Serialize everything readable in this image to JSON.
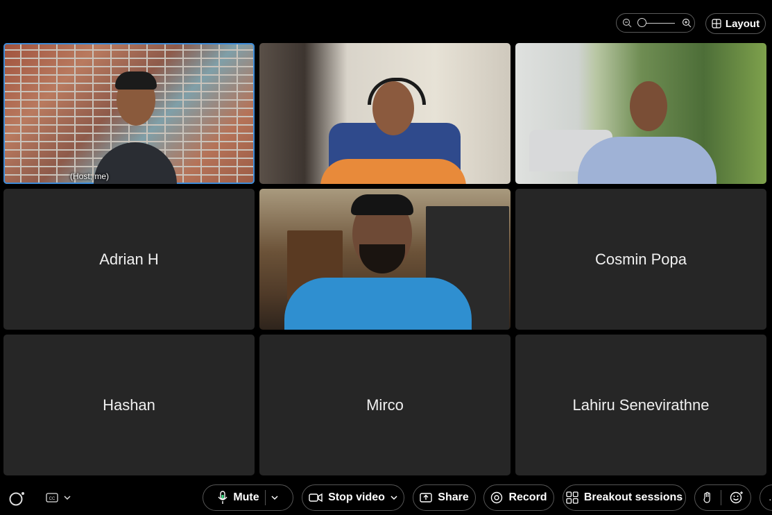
{
  "top": {
    "layout_label": "Layout"
  },
  "participants": [
    {
      "name": "",
      "label": "(Host, me)",
      "video": true
    },
    {
      "name": "",
      "video": true
    },
    {
      "name": "",
      "video": true
    },
    {
      "name": "Adrian H",
      "video": false
    },
    {
      "name": "",
      "video": true
    },
    {
      "name": "Cosmin Popa",
      "video": false
    },
    {
      "name": "Hashan",
      "video": false
    },
    {
      "name": "Mirco",
      "video": false
    },
    {
      "name": "Lahiru Senevirathne",
      "video": false
    }
  ],
  "toolbar": {
    "mute_label": "Mute",
    "stop_video_label": "Stop video",
    "share_label": "Share",
    "record_label": "Record",
    "breakout_label": "Breakout sessions"
  },
  "colors": {
    "background": "#000000",
    "tile": "#262626",
    "active_border": "#3d8bd8"
  },
  "icons": [
    "zoom-out-icon",
    "zoom-in-icon",
    "layout-icon",
    "assistant-icon",
    "captions-icon",
    "chevron-down-icon",
    "microphone-icon",
    "camera-icon",
    "share-icon",
    "record-icon",
    "breakout-icon",
    "raise-hand-icon",
    "reaction-icon",
    "more-icon"
  ]
}
